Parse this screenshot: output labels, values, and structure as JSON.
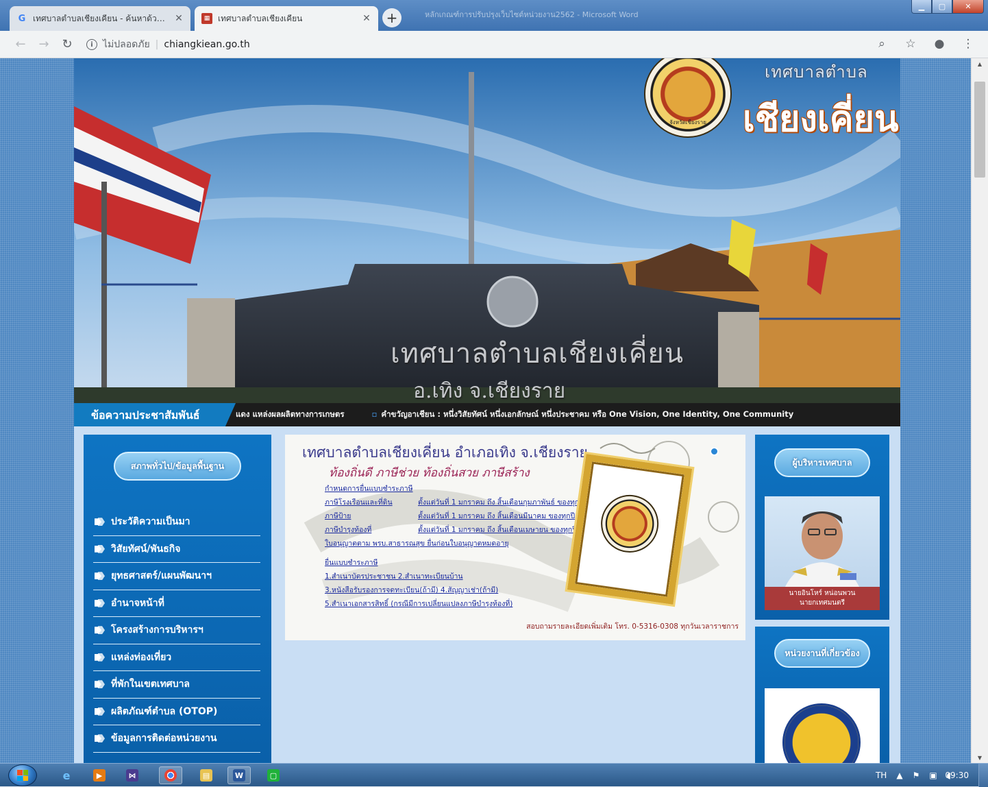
{
  "browser": {
    "tabs": [
      {
        "title": "เทศบาลตำบลเชียงเคียน - ค้นหาด้วย G",
        "favicon": "G",
        "active": false
      },
      {
        "title": "เทศบาลตำบลเชียงเคียน",
        "favicon": "▦",
        "active": true
      }
    ],
    "background_window_title": "หลักเกณฑ์การปรับปรุงเว็บไซต์หน่วยงาน2562 - Microsoft Word",
    "address": {
      "security_label": "ไม่ปลอดภัย",
      "url": "chiangkiean.go.th"
    }
  },
  "site": {
    "brand_small": "เทศบาลตำบล",
    "brand_big": "เชียงเคี่ยน",
    "seal_caption": "จังหวัดเชียงราย",
    "gate_text": "เทศบาลตำบลเชียงเคี่ยน",
    "gate_text_2": "อ.เทิง   จ.เชียงราย"
  },
  "newsbar": {
    "title": "ข้อความประชาสัมพันธ์",
    "items": [
      "แดง แหล่งผลผลิตทางการเกษตร",
      "คำขวัญอาเชียน : หนึ่งวิสัยทัศน์ หนึ่งเอกลักษณ์ หนึ่งประชาคม หรือ One Vision, One Identity, One Community"
    ]
  },
  "left_panel": {
    "ribbon": "สภาพทั่วไป/ข้อมูลพื้นฐาน",
    "menu": [
      "ประวัติความเป็นมา",
      "วิสัยทัศน์/พันธกิจ",
      "ยุทธศาสตร์/แผนพัฒนาฯ",
      "อำนาจหน้าที่",
      "โครงสร้างการบริหารฯ",
      "แหล่งท่องเที่ยว",
      "ที่พักในเขตเทศบาล",
      "ผลิตภัณฑ์ตำบล (OTOP)",
      "ข้อมูลการติดต่อหน่วยงาน"
    ]
  },
  "notice": {
    "title": "เทศบาลตำบลเชียงเคี่ยน อำเภอเทิง จ.เชียงราย",
    "slogan": "ท้องถิ่นดี  ภาษีช่วย  ท้องถิ่นสวย  ภาษีสร้าง",
    "heading": "กำหนดการยื่นแบบชำระภาษี",
    "taxes": [
      {
        "name": "ภาษีโรงเรือนและที่ดิน",
        "period": "ตั้งแต่วันที่  1  มกราคม  ถึง  สิ้นเดือนกุมภาพันธ์ ของทุกปี"
      },
      {
        "name": "ภาษีป้าย",
        "period": "ตั้งแต่วันที่  1  มกราคม  ถึง  สิ้นเดือนมีนาคม  ของทุกปี"
      },
      {
        "name": "ภาษีบำรุงท้องที่",
        "period": "ตั้งแต่วันที่  1  มกราคม  ถึง  สิ้นเดือนเมษายน  ของทุกปี"
      }
    ],
    "license_line": "ใบอนุญาตตาม พรบ.สาธารณสุข ยื่นก่อนใบอนุญาตหมดอายุ",
    "docs_heading": "ยื่นแบบชำระภาษี",
    "docs": [
      "1.สำเนาบัตรประชาชน 2.สำเนาทะเบียนบ้าน",
      "3.หนังสือรับรองการจดทะเบียน(ถ้ามี) 4.สัญญาเช่า(ถ้ามี)",
      "5.สำเนาเอกสารสิทธิ์ (กรณีมีการเปลี่ยนแปลงภาษีบำรุงท้องที่)"
    ],
    "contact": "สอบถามรายละเอียดเพิ่มเติม โทร. 0-5316-0308  ทุกวันเวลาราชการ"
  },
  "right_panel": {
    "ribbon_1": "ผู้บริหารเทศบาล",
    "exec_name": "นายอินโหร์ หน่อนพวน",
    "exec_title": "นายกเทศมนตรี",
    "ribbon_2": "หน่วยงานที่เกี่ยวข้อง"
  },
  "taskbar": {
    "lang": "TH",
    "clock": "09:30"
  },
  "colors": {
    "accent_blue": "#127bc0",
    "panel_blue": "#0e74c3",
    "page_bg": "#c9def4",
    "news_bar": "#1c1c1c"
  }
}
